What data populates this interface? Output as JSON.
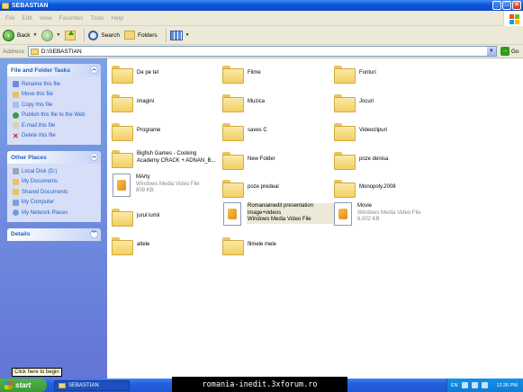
{
  "window": {
    "title": "SEBASTIAN"
  },
  "menu": [
    "File",
    "Edit",
    "View",
    "Favorites",
    "Tools",
    "Help"
  ],
  "toolbar": {
    "back": "Back",
    "search": "Search",
    "folders": "Folders"
  },
  "address": {
    "label": "Address",
    "value": "D:\\SEBASTIAN",
    "go": "Go"
  },
  "sidebar": {
    "file_tasks": {
      "title": "File and Folder Tasks",
      "items": [
        "Rename this file",
        "Move this file",
        "Copy this file",
        "Publish this file to the Web",
        "E-mail this file",
        "Delete this file"
      ]
    },
    "other_places": {
      "title": "Other Places",
      "items": [
        "Local Disk (D:)",
        "My Documents",
        "Shared Documents",
        "My Computer",
        "My Network Places"
      ]
    },
    "details": {
      "title": "Details"
    }
  },
  "files": [
    {
      "name": "De pe tel"
    },
    {
      "name": "Filme"
    },
    {
      "name": "Fonturi"
    },
    {
      "name": "imagini"
    },
    {
      "name": "Muzica"
    },
    {
      "name": "Jocuri"
    },
    {
      "name": "Programe"
    },
    {
      "name": "saves C"
    },
    {
      "name": "Videoclipuri"
    },
    {
      "name": "Bigfish Games - Cooking Academy CRACK + ADNAN_B..."
    },
    {
      "name": "New Folder"
    },
    {
      "name": "poze denisa"
    },
    {
      "name": "MArty",
      "type": "Windows Media Video File",
      "size": "809 KB"
    },
    {
      "name": "poze predeal"
    },
    {
      "name": "Monopoly.2008"
    },
    {
      "name": "jurul lumii"
    },
    {
      "name": "Romaniainedit presentation image+videos",
      "type": "Windows Media Video File"
    },
    {
      "name": "Movie",
      "type": "Windows Media Video File",
      "size": "6,002 KB"
    },
    {
      "name": "altele"
    },
    {
      "name": "filmele mele"
    }
  ],
  "tooltip": "Click here to begin",
  "taskbar": {
    "start": "start",
    "window": "SEBASTIAN",
    "lang": "EN",
    "time": "12:26 PM"
  },
  "watermark": "romania-inedit.3xforum.ro"
}
